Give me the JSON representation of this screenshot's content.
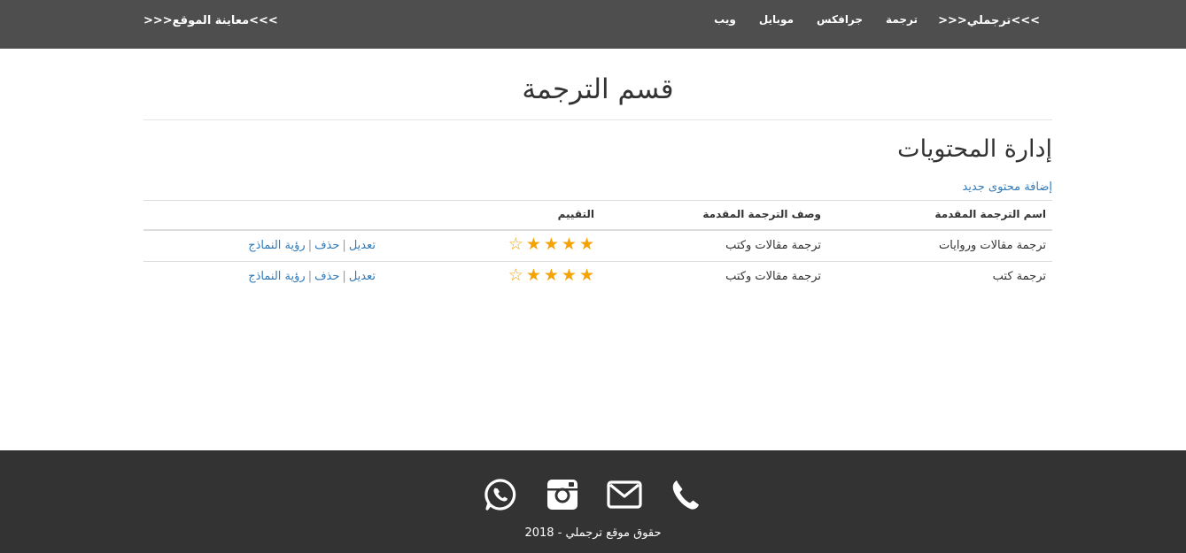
{
  "navbar": {
    "brand": ">>>ترجملي<<<",
    "links": [
      "ترجمة",
      "جرافكس",
      "موبايل",
      "ويب"
    ],
    "preview": ">>>معاينة الموقع<<<"
  },
  "main": {
    "page_title": "قسم الترجمة",
    "section_title": "إدارة المحتويات",
    "add_link": "إضافة محتوى جديد",
    "table": {
      "headers": [
        "اسم الترجمة المقدمة",
        "وصف الترجمة المقدمة",
        "التقييم",
        ""
      ],
      "rows": [
        {
          "name": "ترجمة مقالات وروايات",
          "desc": "ترجمة مقالات وكتب",
          "rating": 4,
          "rating_max": 5,
          "actions": [
            "تعديل",
            "حذف",
            "رؤية النماذج"
          ]
        },
        {
          "name": "ترجمة كتب",
          "desc": "ترجمة مقالات وكتب",
          "rating": 4,
          "rating_max": 5,
          "actions": [
            "تعديل",
            "حذف",
            "رؤية النماذج"
          ]
        }
      ]
    }
  },
  "footer": {
    "icons": [
      "whatsapp-icon",
      "instagram-icon",
      "envelope-icon",
      "phone-icon"
    ],
    "copyright": "حقوق موقع ترجملي - 2018"
  },
  "colors": {
    "navbar_bg": "#4e4e4e",
    "footer_bg": "#333333",
    "link": "#337ab7",
    "star": "#f5a300"
  }
}
